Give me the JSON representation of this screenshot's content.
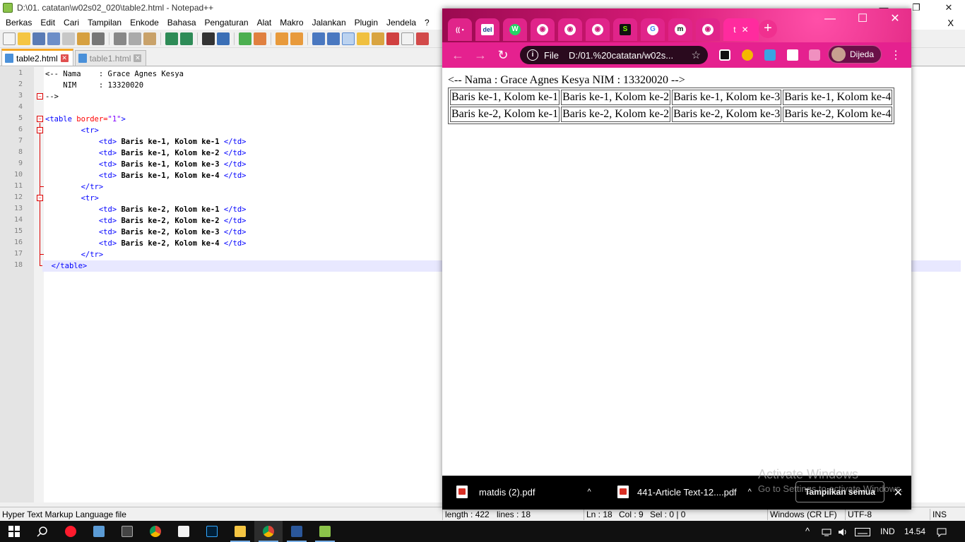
{
  "notepad": {
    "title": "D:\\01. catatan\\w02s02_020\\table2.html - Notepad++",
    "menu": [
      "Berkas",
      "Edit",
      "Cari",
      "Tampilan",
      "Enkode",
      "Bahasa",
      "Pengaturan",
      "Alat",
      "Makro",
      "Jalankan",
      "Plugin",
      "Jendela",
      "?"
    ],
    "menu_close": "X",
    "window_controls": {
      "minimize": "—",
      "restore": "❐",
      "close": "✕"
    },
    "tabs": [
      {
        "label": "table2.html",
        "active": true
      },
      {
        "label": "table1.html",
        "active": false
      }
    ],
    "tab_close": "✕",
    "line_numbers": [
      "1",
      "2",
      "3",
      "4",
      "5",
      "6",
      "7",
      "8",
      "9",
      "10",
      "11",
      "12",
      "13",
      "14",
      "15",
      "16",
      "17",
      "18"
    ],
    "code": {
      "l1": "<-- Nama    : Grace Agnes Kesya",
      "l2": "    NIM     : 13320020",
      "l3": "-->",
      "l5_open": "<table",
      "l5_attr": " border=",
      "l5_val": "\"1\"",
      "l5_close": ">",
      "tr_open": "<tr>",
      "tr_close": "</tr>",
      "td_open": "<td>",
      "td_close": " </td>",
      "r1c1": " Baris ke-1, Kolom ke-1",
      "r1c2": " Baris ke-1, Kolom ke-2",
      "r1c3": " Baris ke-1, Kolom ke-3",
      "r1c4": " Baris ke-1, Kolom ke-4",
      "r2c1": " Baris ke-2, Kolom ke-1",
      "r2c2": " Baris ke-2, Kolom ke-2",
      "r2c3": " Baris ke-2, Kolom ke-3",
      "r2c4": " Baris ke-2, Kolom ke-4",
      "table_close": "</table>"
    },
    "status": {
      "filetype": "Hyper Text Markup Language file",
      "length": "length : 422",
      "lines": "lines : 18",
      "ln": "Ln : 18",
      "col": "Col : 9",
      "sel": "Sel : 0 | 0",
      "eol": "Windows (CR LF)",
      "encoding": "UTF-8",
      "mode": "INS"
    }
  },
  "chrome": {
    "active_tab_letter": "t",
    "tab_close": "✕",
    "tab_icons": [
      "(( •",
      "del",
      "W",
      "◉",
      "◉",
      "◉",
      "S",
      "G",
      "m",
      "◉"
    ],
    "new_tab": "+",
    "window_controls": {
      "minimize": "—",
      "maximize": "☐",
      "close": "✕"
    },
    "nav": {
      "back": "←",
      "forward": "→",
      "reload": "↻"
    },
    "omnibox": {
      "info": "i",
      "scheme": "File",
      "url": "D:/01.%20catatan/w02s...",
      "star": "☆"
    },
    "profile_name": "Dijeda",
    "menu": "⋮",
    "page": {
      "comment": "<-- Nama : Grace Agnes Kesya NIM : 13320020 -->",
      "table": [
        [
          "Baris ke-1, Kolom ke-1",
          "Baris ke-1, Kolom ke-2",
          "Baris ke-1, Kolom ke-3",
          "Baris ke-1, Kolom ke-4"
        ],
        [
          "Baris ke-2, Kolom ke-1",
          "Baris ke-2, Kolom ke-2",
          "Baris ke-2, Kolom ke-3",
          "Baris ke-2, Kolom ke-4"
        ]
      ]
    },
    "downloads": [
      {
        "name": "matdis (2).pdf"
      },
      {
        "name": "441-Article Text-12....pdf"
      }
    ],
    "download_chevron": "^",
    "show_all": "Tampilkan semua",
    "download_close": "✕"
  },
  "watermark": {
    "line1": "Activate Windows",
    "line2": "Go to Settings to activate Windows."
  },
  "taskbar": {
    "tray_chevron": "^",
    "language": "IND",
    "time": "14.54"
  },
  "colors": {
    "chrome_accent": "#e5218f",
    "npp_tab_accent": "#f5a623",
    "html_tag": "#0000ff",
    "html_attr": "#ff0000",
    "html_value": "#8000ff"
  }
}
